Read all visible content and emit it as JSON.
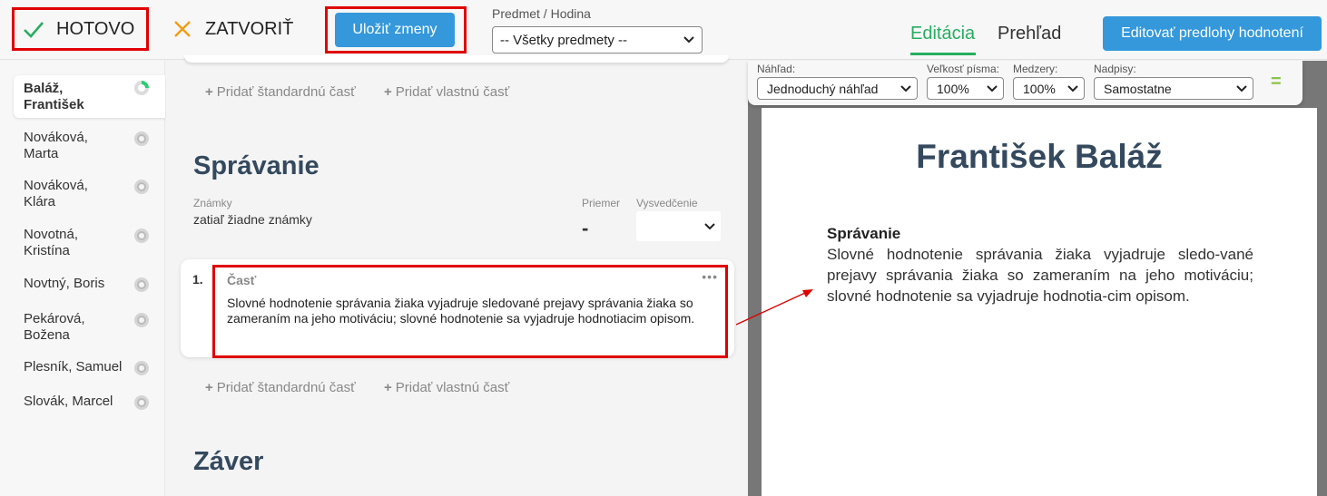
{
  "topbar": {
    "done_label": "HOTOVO",
    "close_label": "ZATVORIŤ",
    "save_label": "Uložiť zmeny",
    "subject_label": "Predmet / Hodina",
    "subject_value": "-- Všetky predmety --",
    "tab_edit": "Editácia",
    "tab_overview": "Prehľad",
    "edit_templates_label": "Editovať predlohy hodnotení"
  },
  "sidebar": {
    "students": [
      {
        "name": "Baláž, František",
        "active": true
      },
      {
        "name": "Nováková, Marta",
        "active": false
      },
      {
        "name": "Nováková, Klára",
        "active": false
      },
      {
        "name": "Novotná, Kristína",
        "active": false
      },
      {
        "name": "Novtný, Boris",
        "active": false
      },
      {
        "name": "Pekárová, Božena",
        "active": false
      },
      {
        "name": "Plesník, Samuel",
        "active": false
      },
      {
        "name": "Slovák, Marcel",
        "active": false
      }
    ]
  },
  "editor": {
    "add_standard": "Pridať štandardnú časť",
    "add_custom": "Pridať vlastnú časť",
    "section_title": "Správanie",
    "grades_label": "Známky",
    "grades_value": "zatiaľ žiadne známky",
    "average_label": "Priemer",
    "average_value": "-",
    "certificate_label": "Vysvedčenie",
    "part": {
      "number": "1.",
      "title": "Časť",
      "menu": "•••",
      "text": "Slovné hodnotenie správania žiaka vyjadruje sledované prejavy správania žiaka so zameraním na jeho motiváciu; slovné hodnotenie sa vyjadruje hodnotiacim opisom."
    },
    "next_section_title": "Záver"
  },
  "preview": {
    "toolbar": {
      "view_label": "Náhľad:",
      "view_value": "Jednoduchý náhľad",
      "font_size_label": "Veľkosť písma:",
      "font_size_value": "100%",
      "spacing_label": "Medzery:",
      "spacing_value": "100%",
      "headings_label": "Nadpisy:",
      "headings_value": "Samostatne",
      "collapse_icon": "="
    },
    "student_name": "František Baláž",
    "section_title": "Správanie",
    "section_text": "Slovné hodnotenie správania žiaka vyjadruje sledo-vané prejavy správania žiaka so zameraním na jeho motiváciu; slovné hodnotenie sa vyjadruje hodnotia-cim opisom."
  },
  "colors": {
    "accent_green": "#27ae60",
    "button_blue": "#3498db",
    "highlight_red": "#e00000",
    "heading_navy": "#34495e"
  }
}
